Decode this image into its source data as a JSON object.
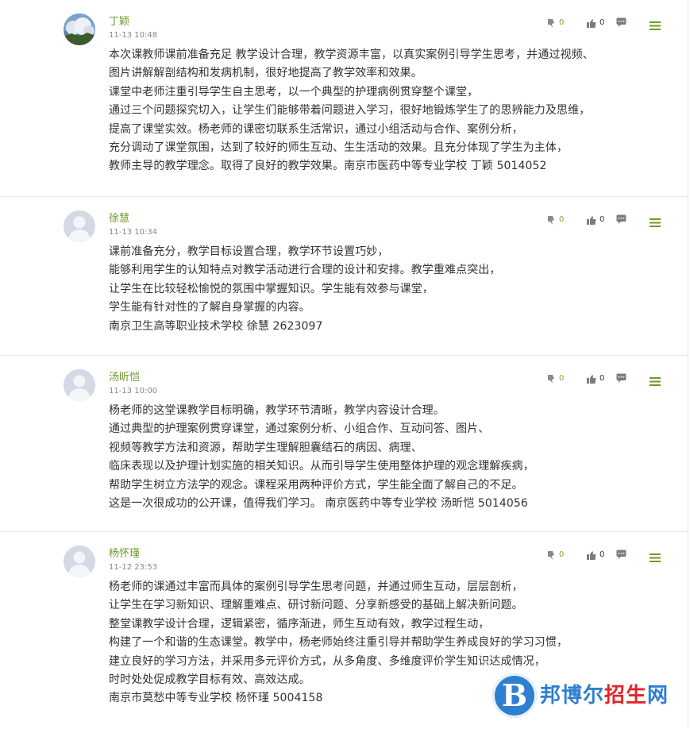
{
  "comments": [
    {
      "name": "丁颖",
      "time": "11-13 10:48",
      "avatar": "landscape-photo",
      "oppose_count": "0",
      "like_count": "0",
      "text": "本次课教师课前准备充足 教学设计合理，教学资源丰富，以真实案例引导学生思考，并通过视频、\n图片讲解解剖结构和发病机制，很好地提高了教学效率和效果。\n课堂中老师注重引导学生自主思考，以一个典型的护理病例贯穿整个课堂，\n通过三个问题探究切入，让学生们能够带着问题进入学习，很好地锻炼学生了的思辨能力及思维，\n提高了课堂实效。杨老师的课密切联系生活常识，通过小组活动与合作、案例分析，\n充分调动了课堂氛围，达到了较好的师生互动、生生活动的效果。且充分体现了学生为主体，\n教师主导的教学理念。取得了良好的教学效果。南京市医药中等专业学校 丁颖 5014052"
    },
    {
      "name": "徐慧",
      "time": "11-13 10:34",
      "avatar": "default-user",
      "oppose_count": "0",
      "like_count": "0",
      "text": "课前准备充分，教学目标设置合理，教学环节设置巧妙，\n能够利用学生的认知特点对教学活动进行合理的设计和安排。教学重难点突出，\n让学生在比较轻松愉悦的氛围中掌握知识。学生能有效参与课堂，\n学生能有针对性的了解自身掌握的内容。\n南京卫生高等职业技术学校 徐慧 2623097"
    },
    {
      "name": "汤昕恺",
      "time": "11-13 10:00",
      "avatar": "default-user",
      "oppose_count": "0",
      "like_count": "0",
      "text": "杨老师的这堂课教学目标明确，教学环节清晰，教学内容设计合理。\n通过典型的护理案例贯穿课堂，通过案例分析、小组合作、互动问答、图片、\n视频等教学方法和资源，帮助学生理解胆囊结石的病因、病理、\n临床表现以及护理计划实施的相关知识。从而引导学生使用整体护理的观念理解疾病，\n帮助学生树立方法学的观念。课程采用两种评价方式，学生能全面了解自己的不足。\n这是一次很成功的公开课，值得我们学习。 南京医药中等专业学校 汤昕恺 5014056"
    },
    {
      "name": "杨怀瑾",
      "time": "11-12 23:53",
      "avatar": "default-user",
      "oppose_count": "0",
      "like_count": "0",
      "text": "杨老师的课通过丰富而具体的案例引导学生思考问题，并通过师生互动，层层剖析，\n让学生在学习新知识、理解重难点、研讨新问题、分享新感受的基础上解决新问题。\n整堂课教学设计合理，逻辑紧密，循序渐进，师生互动有效，教学过程生动，\n构建了一个和谐的生态课堂。教学中，杨老师始终注重引导并帮助学生养成良好的学习习惯，\n建立良好的学习方法，并采用多元评价方式，从多角度、多维度评价学生知识达成情况，\n时时处处促成教学目标有效、高效达成。\n南京市莫愁中等专业学校 杨怀瑾 5004158"
    }
  ],
  "watermark": {
    "logo_letter": "B",
    "text_part1": "邦博尔",
    "text_part2": "招生",
    "text_part3": "网"
  },
  "colors": {
    "name": "#6d9b2a",
    "oppose_icon": "#8aaa3a",
    "menu_icon": "#6d9b2a",
    "watermark_blue": "#2f7fd0",
    "watermark_red": "#e0262b"
  }
}
